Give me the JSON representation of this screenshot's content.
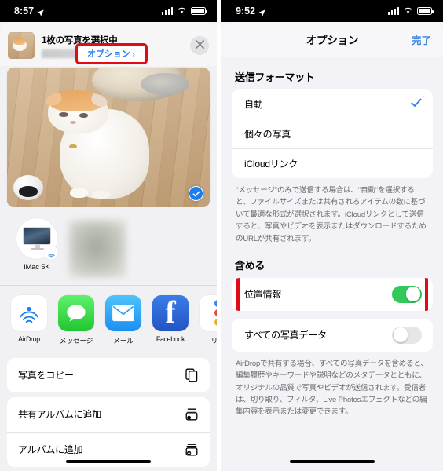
{
  "left_screen": {
    "status_bar": {
      "time": "8:57",
      "location_icon": "location-arrow-icon",
      "signal": "cellular-signal-icon",
      "wifi": "wifi-icon",
      "battery": "battery-icon"
    },
    "share_header": {
      "title": "1枚の写真を選択中",
      "subtitle_blurred": "",
      "options_link": "オプション",
      "options_chevron": "›",
      "close_icon": "close-icon",
      "thumbnail": "photo-thumbnail"
    },
    "photo_preview": {
      "name": "cat-photo-preview",
      "selected_badge": "checkmark-badge"
    },
    "airdrop": {
      "device_label": "iMac 5K",
      "device_icon": "imac-icon",
      "badge_icon": "airdrop-icon"
    },
    "apps": [
      {
        "label": "AirDrop",
        "icon": "airdrop-icon"
      },
      {
        "label": "メッセージ",
        "icon": "messages-icon"
      },
      {
        "label": "メール",
        "icon": "mail-icon"
      },
      {
        "label": "Facebook",
        "icon": "facebook-icon"
      },
      {
        "label": "リマ",
        "icon": "reminders-icon"
      }
    ],
    "actions": [
      {
        "label": "写真をコピー",
        "icon": "copy-icon"
      },
      {
        "label": "共有アルバムに追加",
        "icon": "shared-album-icon"
      },
      {
        "label": "アルバムに追加",
        "icon": "add-to-album-icon"
      }
    ]
  },
  "right_screen": {
    "status_bar": {
      "time": "9:52",
      "location_icon": "location-arrow-icon",
      "signal": "cellular-signal-icon",
      "wifi": "wifi-icon",
      "battery": "battery-icon"
    },
    "nav": {
      "title": "オプション",
      "done": "完了"
    },
    "format_section": {
      "title": "送信フォーマット",
      "options": [
        {
          "label": "自動",
          "selected": true
        },
        {
          "label": "個々の写真",
          "selected": false
        },
        {
          "label": "iCloudリンク",
          "selected": false
        }
      ],
      "footnote": "\"メッセージ\"のみで送信する場合は、\"自動\"を選択すると、ファイルサイズまたは共有されるアイテムの数に基づいて最適な形式が選択されます。iCloudリンクとして送信すると、写真やビデオを表示またはダウンロードするためのURLが共有されます。"
    },
    "include_section": {
      "title": "含める",
      "rows": [
        {
          "label": "位置情報",
          "state": "on",
          "highlighted": true
        },
        {
          "label": "すべての写真データ",
          "state": "off",
          "highlighted": false
        }
      ],
      "footnote": "AirDropで共有する場合、すべての写真データを含めると、編集履歴やキーワードや説明などのメタデータとともに、オリジナルの品質で写真やビデオが送信されます。受信者は、切り取り、フィルタ、Live Photosエフェクトなどの編集内容を表示または変更できます。"
    }
  },
  "colors": {
    "accent_blue": "#3b84e3",
    "toggle_on": "#33c85a",
    "highlight_red": "#e30a17",
    "checkmark_blue": "#1a7ef0"
  }
}
